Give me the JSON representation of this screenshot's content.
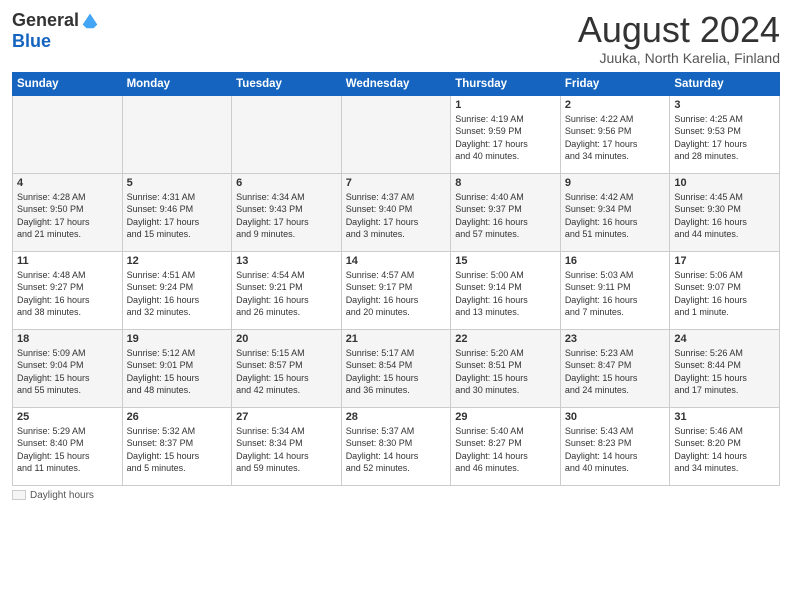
{
  "header": {
    "logo_general": "General",
    "logo_blue": "Blue",
    "month_title": "August 2024",
    "location": "Juuka, North Karelia, Finland"
  },
  "days_of_week": [
    "Sunday",
    "Monday",
    "Tuesday",
    "Wednesday",
    "Thursday",
    "Friday",
    "Saturday"
  ],
  "legend": {
    "label": "Daylight hours"
  },
  "weeks": [
    {
      "days": [
        {
          "num": "",
          "info": "",
          "empty": true
        },
        {
          "num": "",
          "info": "",
          "empty": true
        },
        {
          "num": "",
          "info": "",
          "empty": true
        },
        {
          "num": "",
          "info": "",
          "empty": true
        },
        {
          "num": "1",
          "info": "Sunrise: 4:19 AM\nSunset: 9:59 PM\nDaylight: 17 hours\nand 40 minutes."
        },
        {
          "num": "2",
          "info": "Sunrise: 4:22 AM\nSunset: 9:56 PM\nDaylight: 17 hours\nand 34 minutes."
        },
        {
          "num": "3",
          "info": "Sunrise: 4:25 AM\nSunset: 9:53 PM\nDaylight: 17 hours\nand 28 minutes."
        }
      ]
    },
    {
      "days": [
        {
          "num": "4",
          "info": "Sunrise: 4:28 AM\nSunset: 9:50 PM\nDaylight: 17 hours\nand 21 minutes."
        },
        {
          "num": "5",
          "info": "Sunrise: 4:31 AM\nSunset: 9:46 PM\nDaylight: 17 hours\nand 15 minutes."
        },
        {
          "num": "6",
          "info": "Sunrise: 4:34 AM\nSunset: 9:43 PM\nDaylight: 17 hours\nand 9 minutes."
        },
        {
          "num": "7",
          "info": "Sunrise: 4:37 AM\nSunset: 9:40 PM\nDaylight: 17 hours\nand 3 minutes."
        },
        {
          "num": "8",
          "info": "Sunrise: 4:40 AM\nSunset: 9:37 PM\nDaylight: 16 hours\nand 57 minutes."
        },
        {
          "num": "9",
          "info": "Sunrise: 4:42 AM\nSunset: 9:34 PM\nDaylight: 16 hours\nand 51 minutes."
        },
        {
          "num": "10",
          "info": "Sunrise: 4:45 AM\nSunset: 9:30 PM\nDaylight: 16 hours\nand 44 minutes."
        }
      ]
    },
    {
      "days": [
        {
          "num": "11",
          "info": "Sunrise: 4:48 AM\nSunset: 9:27 PM\nDaylight: 16 hours\nand 38 minutes."
        },
        {
          "num": "12",
          "info": "Sunrise: 4:51 AM\nSunset: 9:24 PM\nDaylight: 16 hours\nand 32 minutes."
        },
        {
          "num": "13",
          "info": "Sunrise: 4:54 AM\nSunset: 9:21 PM\nDaylight: 16 hours\nand 26 minutes."
        },
        {
          "num": "14",
          "info": "Sunrise: 4:57 AM\nSunset: 9:17 PM\nDaylight: 16 hours\nand 20 minutes."
        },
        {
          "num": "15",
          "info": "Sunrise: 5:00 AM\nSunset: 9:14 PM\nDaylight: 16 hours\nand 13 minutes."
        },
        {
          "num": "16",
          "info": "Sunrise: 5:03 AM\nSunset: 9:11 PM\nDaylight: 16 hours\nand 7 minutes."
        },
        {
          "num": "17",
          "info": "Sunrise: 5:06 AM\nSunset: 9:07 PM\nDaylight: 16 hours\nand 1 minute."
        }
      ]
    },
    {
      "days": [
        {
          "num": "18",
          "info": "Sunrise: 5:09 AM\nSunset: 9:04 PM\nDaylight: 15 hours\nand 55 minutes."
        },
        {
          "num": "19",
          "info": "Sunrise: 5:12 AM\nSunset: 9:01 PM\nDaylight: 15 hours\nand 48 minutes."
        },
        {
          "num": "20",
          "info": "Sunrise: 5:15 AM\nSunset: 8:57 PM\nDaylight: 15 hours\nand 42 minutes."
        },
        {
          "num": "21",
          "info": "Sunrise: 5:17 AM\nSunset: 8:54 PM\nDaylight: 15 hours\nand 36 minutes."
        },
        {
          "num": "22",
          "info": "Sunrise: 5:20 AM\nSunset: 8:51 PM\nDaylight: 15 hours\nand 30 minutes."
        },
        {
          "num": "23",
          "info": "Sunrise: 5:23 AM\nSunset: 8:47 PM\nDaylight: 15 hours\nand 24 minutes."
        },
        {
          "num": "24",
          "info": "Sunrise: 5:26 AM\nSunset: 8:44 PM\nDaylight: 15 hours\nand 17 minutes."
        }
      ]
    },
    {
      "days": [
        {
          "num": "25",
          "info": "Sunrise: 5:29 AM\nSunset: 8:40 PM\nDaylight: 15 hours\nand 11 minutes."
        },
        {
          "num": "26",
          "info": "Sunrise: 5:32 AM\nSunset: 8:37 PM\nDaylight: 15 hours\nand 5 minutes."
        },
        {
          "num": "27",
          "info": "Sunrise: 5:34 AM\nSunset: 8:34 PM\nDaylight: 14 hours\nand 59 minutes."
        },
        {
          "num": "28",
          "info": "Sunrise: 5:37 AM\nSunset: 8:30 PM\nDaylight: 14 hours\nand 52 minutes."
        },
        {
          "num": "29",
          "info": "Sunrise: 5:40 AM\nSunset: 8:27 PM\nDaylight: 14 hours\nand 46 minutes."
        },
        {
          "num": "30",
          "info": "Sunrise: 5:43 AM\nSunset: 8:23 PM\nDaylight: 14 hours\nand 40 minutes."
        },
        {
          "num": "31",
          "info": "Sunrise: 5:46 AM\nSunset: 8:20 PM\nDaylight: 14 hours\nand 34 minutes."
        }
      ]
    }
  ]
}
